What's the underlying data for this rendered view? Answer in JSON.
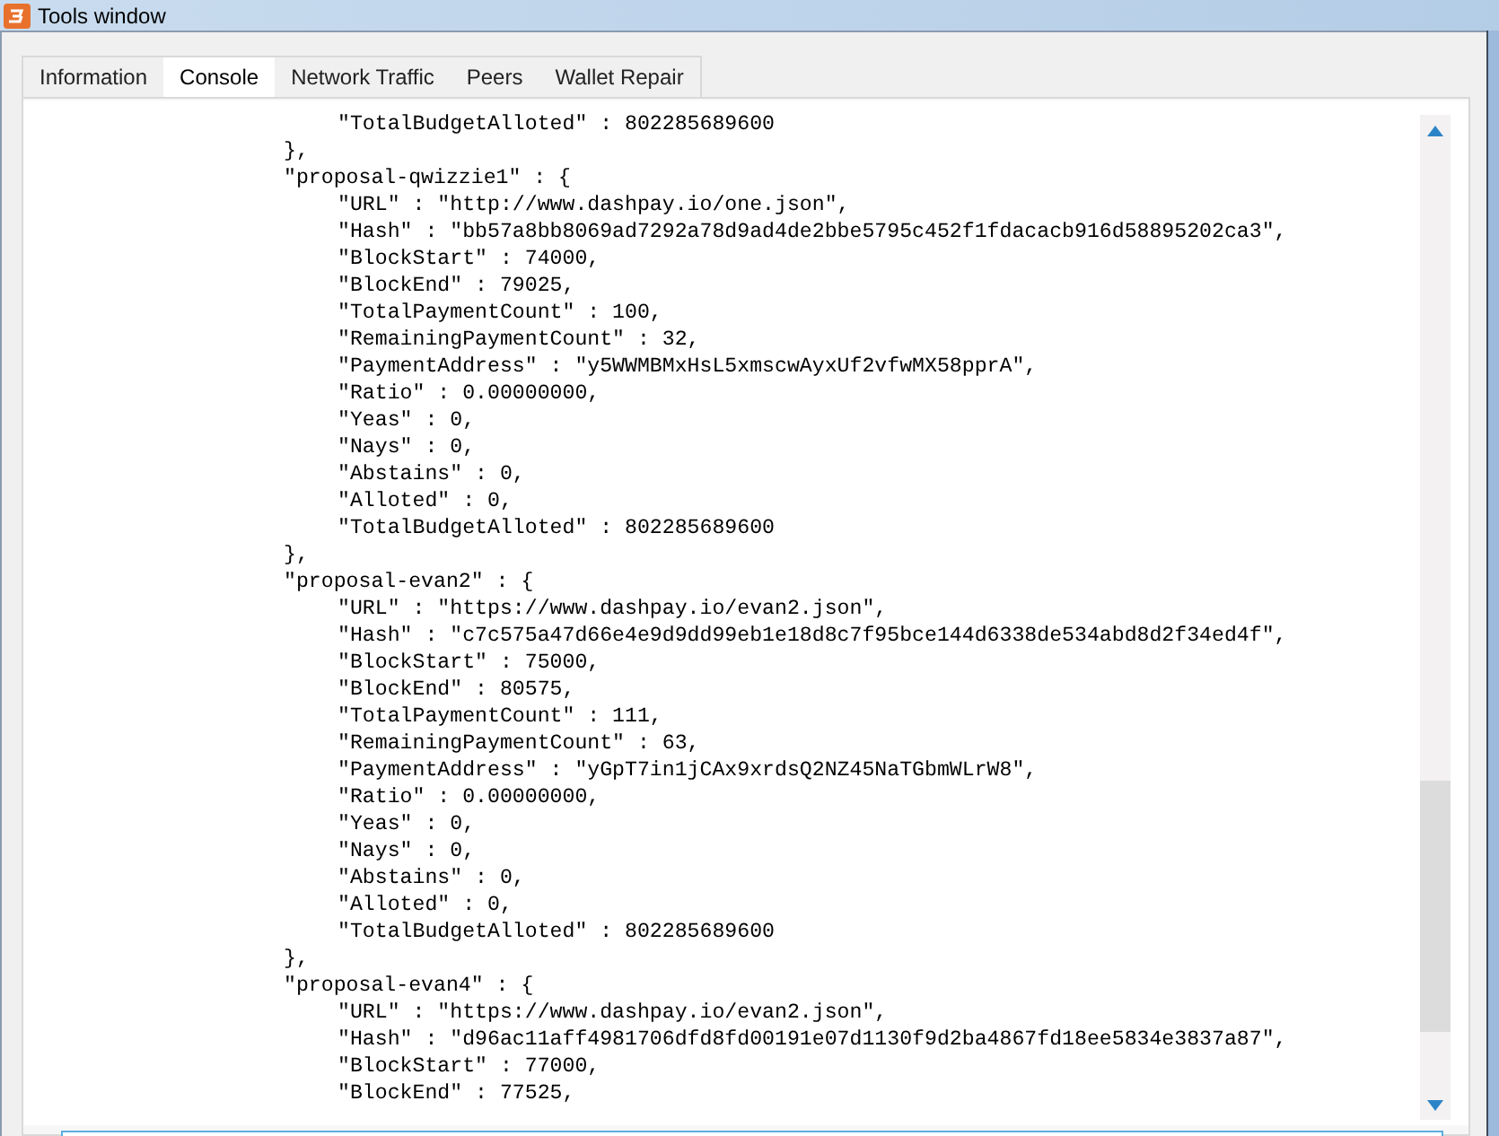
{
  "window": {
    "title": "Tools window"
  },
  "tabs": [
    {
      "label": "Information",
      "selected": false
    },
    {
      "label": "Console",
      "selected": true
    },
    {
      "label": "Network Traffic",
      "selected": false
    },
    {
      "label": "Peers",
      "selected": false
    },
    {
      "label": "Wallet Repair",
      "selected": false
    }
  ],
  "console": {
    "lines": [
      {
        "children": [
          {
            "text": "\"TotalBudgetAlloted\" : 802285689600"
          }
        ]
      },
      {
        "text": "},"
      },
      {
        "text": "\"proposal-qwizzie1\" : {",
        "children": [
          {
            "text": "\"URL\" : \"http://www.dashpay.io/one.json\","
          },
          {
            "text": "\"Hash\" : \"bb57a8bb8069ad7292a78d9ad4de2bbe5795c452f1fdacacb916d58895202ca3\","
          },
          {
            "text": "\"BlockStart\" : 74000,"
          },
          {
            "text": "\"BlockEnd\" : 79025,"
          },
          {
            "text": "\"TotalPaymentCount\" : 100,"
          },
          {
            "text": "\"RemainingPaymentCount\" : 32,"
          },
          {
            "text": "\"PaymentAddress\" : \"y5WWMBMxHsL5xmscwAyxUf2vfwMX58pprA\","
          },
          {
            "text": "\"Ratio\" : 0.00000000,"
          },
          {
            "text": "\"Yeas\" : 0,"
          },
          {
            "text": "\"Nays\" : 0,"
          },
          {
            "text": "\"Abstains\" : 0,"
          },
          {
            "text": "\"Alloted\" : 0,"
          },
          {
            "text": "\"TotalBudgetAlloted\" : 802285689600"
          }
        ]
      },
      {
        "text": "},"
      },
      {
        "text": "\"proposal-evan2\" : {",
        "children": [
          {
            "text": "\"URL\" : \"https://www.dashpay.io/evan2.json\","
          },
          {
            "text": "\"Hash\" : \"c7c575a47d66e4e9d9dd99eb1e18d8c7f95bce144d6338de534abd8d2f34ed4f\","
          },
          {
            "text": "\"BlockStart\" : 75000,"
          },
          {
            "text": "\"BlockEnd\" : 80575,"
          },
          {
            "text": "\"TotalPaymentCount\" : 111,"
          },
          {
            "text": "\"RemainingPaymentCount\" : 63,"
          },
          {
            "text": "\"PaymentAddress\" : \"yGpT7in1jCAx9xrdsQ2NZ45NaTGbmWLrW8\","
          },
          {
            "text": "\"Ratio\" : 0.00000000,"
          },
          {
            "text": "\"Yeas\" : 0,"
          },
          {
            "text": "\"Nays\" : 0,"
          },
          {
            "text": "\"Abstains\" : 0,"
          },
          {
            "text": "\"Alloted\" : 0,"
          },
          {
            "text": "\"TotalBudgetAlloted\" : 802285689600"
          }
        ]
      },
      {
        "text": "},"
      },
      {
        "text": "\"proposal-evan4\" : {",
        "children": [
          {
            "text": "\"URL\" : \"https://www.dashpay.io/evan2.json\","
          },
          {
            "text": "\"Hash\" : \"d96ac11aff4981706dfd8fd00191e07d1130f9d2ba4867fd18ee5834e3837a87\","
          },
          {
            "text": "\"BlockStart\" : 77000,"
          },
          {
            "text": "\"BlockEnd\" : 77525,"
          }
        ]
      }
    ]
  }
}
